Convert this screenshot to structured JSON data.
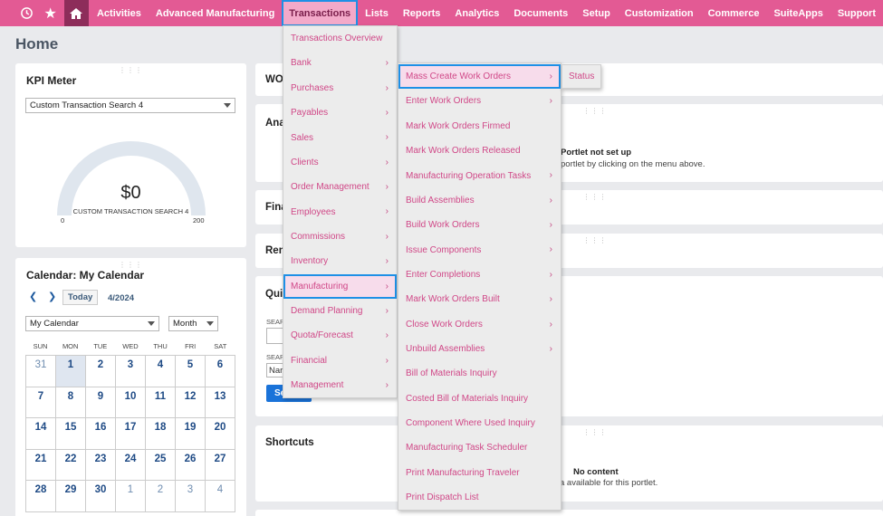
{
  "topnav": {
    "items": [
      "Activities",
      "Advanced Manufacturing",
      "Transactions",
      "Lists",
      "Reports",
      "Analytics",
      "Documents",
      "Setup",
      "Customization",
      "Commerce",
      "SuiteApps",
      "Support"
    ],
    "active": "Transactions",
    "icons": [
      "recent-icon",
      "star-icon",
      "home-icon"
    ]
  },
  "page": {
    "title": "Home"
  },
  "kpi": {
    "title": "KPI Meter",
    "select_value": "Custom Transaction Search 4",
    "value": "$0",
    "caption": "CUSTOM TRANSACTION SEARCH 4",
    "min": "0",
    "max": "200"
  },
  "calendar": {
    "title": "Calendar: My Calendar",
    "today_label": "Today",
    "month_label": "4/2024",
    "calendar_select": "My Calendar",
    "view_select": "Month",
    "weekdays": [
      "SUN",
      "MON",
      "TUE",
      "WED",
      "THU",
      "FRI",
      "SAT"
    ],
    "days": [
      "31",
      "1",
      "2",
      "3",
      "4",
      "5",
      "6",
      "7",
      "8",
      "9",
      "10",
      "11",
      "12",
      "13",
      "14",
      "15",
      "16",
      "17",
      "18",
      "19",
      "20",
      "21",
      "22",
      "23",
      "24",
      "25",
      "26",
      "27",
      "28",
      "29",
      "30",
      "1",
      "2",
      "3",
      "4"
    ]
  },
  "right": {
    "wo_label": "WO",
    "ana_label": "Ana",
    "portlet_msg_title": "Portlet not set up",
    "portlet_msg_body": "portlet by clicking on the menu above.",
    "fina_label": "Fina",
    "rem_label": "Rem",
    "qui_label": "Qui",
    "sear1": "SEAR",
    "sear2": "SEAR",
    "nar": "Nar",
    "btn": "Se",
    "shortcuts_title": "Shortcuts",
    "no_content": "No content",
    "no_content_body": "a available for this portlet."
  },
  "menu_transactions": [
    {
      "label": "Transactions Overview",
      "sub": false
    },
    {
      "label": "Bank",
      "sub": true
    },
    {
      "label": "Purchases",
      "sub": true
    },
    {
      "label": "Payables",
      "sub": true
    },
    {
      "label": "Sales",
      "sub": true
    },
    {
      "label": "Clients",
      "sub": true
    },
    {
      "label": "Order Management",
      "sub": true
    },
    {
      "label": "Employees",
      "sub": true
    },
    {
      "label": "Commissions",
      "sub": true
    },
    {
      "label": "Inventory",
      "sub": true
    },
    {
      "label": "Manufacturing",
      "sub": true,
      "highlighted": true
    },
    {
      "label": "Demand Planning",
      "sub": true
    },
    {
      "label": "Quota/Forecast",
      "sub": true
    },
    {
      "label": "Financial",
      "sub": true
    },
    {
      "label": "Management",
      "sub": true
    }
  ],
  "menu_manufacturing": [
    {
      "label": "Mass Create Work Orders",
      "sub": true,
      "highlighted": true
    },
    {
      "label": "Enter Work Orders",
      "sub": true
    },
    {
      "label": "Mark Work Orders Firmed",
      "sub": false
    },
    {
      "label": "Mark Work Orders Released",
      "sub": false
    },
    {
      "label": "Manufacturing Operation Tasks",
      "sub": true
    },
    {
      "label": "Build Assemblies",
      "sub": true
    },
    {
      "label": "Build Work Orders",
      "sub": true
    },
    {
      "label": "Issue Components",
      "sub": true
    },
    {
      "label": "Enter Completions",
      "sub": true
    },
    {
      "label": "Mark Work Orders Built",
      "sub": true
    },
    {
      "label": "Close Work Orders",
      "sub": true
    },
    {
      "label": "Unbuild Assemblies",
      "sub": true
    },
    {
      "label": "Bill of Materials Inquiry",
      "sub": false
    },
    {
      "label": "Costed Bill of Materials Inquiry",
      "sub": false
    },
    {
      "label": "Component Where Used Inquiry",
      "sub": false
    },
    {
      "label": "Manufacturing Task Scheduler",
      "sub": false
    },
    {
      "label": "Print Manufacturing Traveler",
      "sub": false
    },
    {
      "label": "Print Dispatch List",
      "sub": false
    }
  ],
  "menu_mass_create": {
    "label": "Status"
  }
}
